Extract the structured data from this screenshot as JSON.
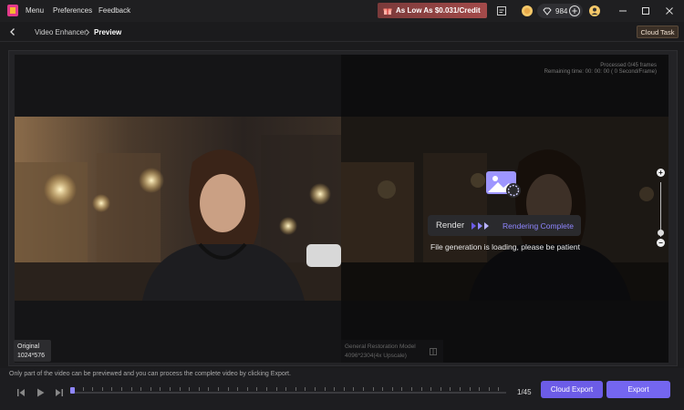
{
  "app": {
    "menu": [
      "Menu",
      "Preferences",
      "Feedback"
    ],
    "promo": "As Low As $0.031/Credit",
    "credits": "984"
  },
  "nav": {
    "back": "",
    "breadcrumb_parent": "Video Enhancer",
    "breadcrumb_current": "Preview",
    "cloud_task": "Cloud Task"
  },
  "preview": {
    "processed": "Processed 0/45 frames",
    "remaining": "Remaining time: 00: 00: 00 ( 0 Second/Frame)",
    "original_label": "Original",
    "original_size": "1024*576",
    "model_name": "General Restoration Model",
    "model_size": "4096*2304(4x Upscale)",
    "render_label": "Render",
    "render_status": "Rendering Complete",
    "render_message": "File generation is loading, please be patient"
  },
  "footer": {
    "note": "Only part of the video can be previewed and you can process the complete video by clicking Export.",
    "frame_counter": "1/45",
    "cloud_export": "Cloud Export",
    "export": "Export"
  },
  "colors": {
    "accent": "#7466f0",
    "promo": "#a34a4a"
  }
}
